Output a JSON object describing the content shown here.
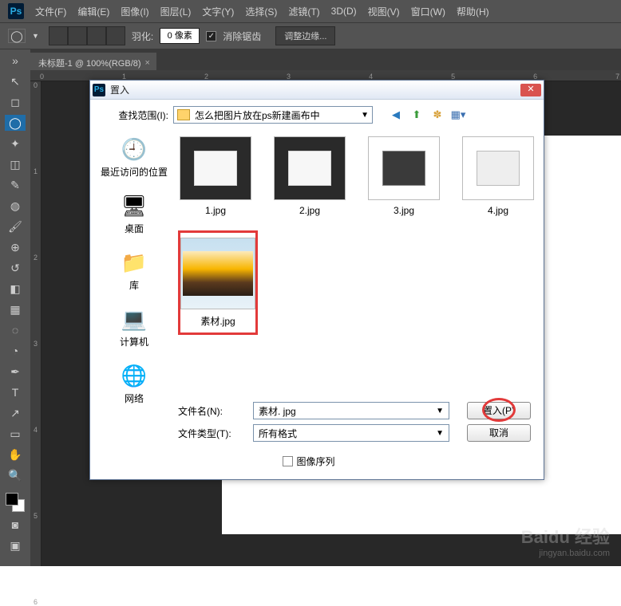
{
  "menu": {
    "items": [
      "文件(F)",
      "编辑(E)",
      "图像(I)",
      "图层(L)",
      "文字(Y)",
      "选择(S)",
      "滤镜(T)",
      "3D(D)",
      "视图(V)",
      "窗口(W)",
      "帮助(H)"
    ]
  },
  "optbar": {
    "feather_label": "羽化:",
    "feather_value": "0 像素",
    "antialias": "消除锯齿",
    "refine": "调整边缘..."
  },
  "tab": {
    "title": "未标题-1 @ 100%(RGB/8)",
    "close": "×"
  },
  "ruler_h": [
    "0",
    "1",
    "2",
    "3",
    "4",
    "5",
    "6",
    "7"
  ],
  "ruler_v": [
    "0",
    "1",
    "2",
    "3",
    "4",
    "5",
    "6"
  ],
  "dialog": {
    "title": "置入",
    "lookin_label": "查找范围(I):",
    "lookin_value": "怎么把图片放在ps新建画布中",
    "sidebar": {
      "recent": "最近访问的位置",
      "desktop": "桌面",
      "libraries": "库",
      "computer": "计算机",
      "network": "网络"
    },
    "files": {
      "row1": [
        "1.jpg",
        "2.jpg",
        "3.jpg",
        "4.jpg"
      ],
      "selected": "素材.jpg"
    },
    "filename_label": "文件名(N):",
    "filename_value": "素材. jpg",
    "filetype_label": "文件类型(T):",
    "filetype_value": "所有格式",
    "place_btn": "置入(P)",
    "cancel_btn": "取消",
    "seq_label": "图像序列"
  },
  "watermark": {
    "main": "Baidu 经验",
    "sub": "jingyan.baidu.com"
  }
}
